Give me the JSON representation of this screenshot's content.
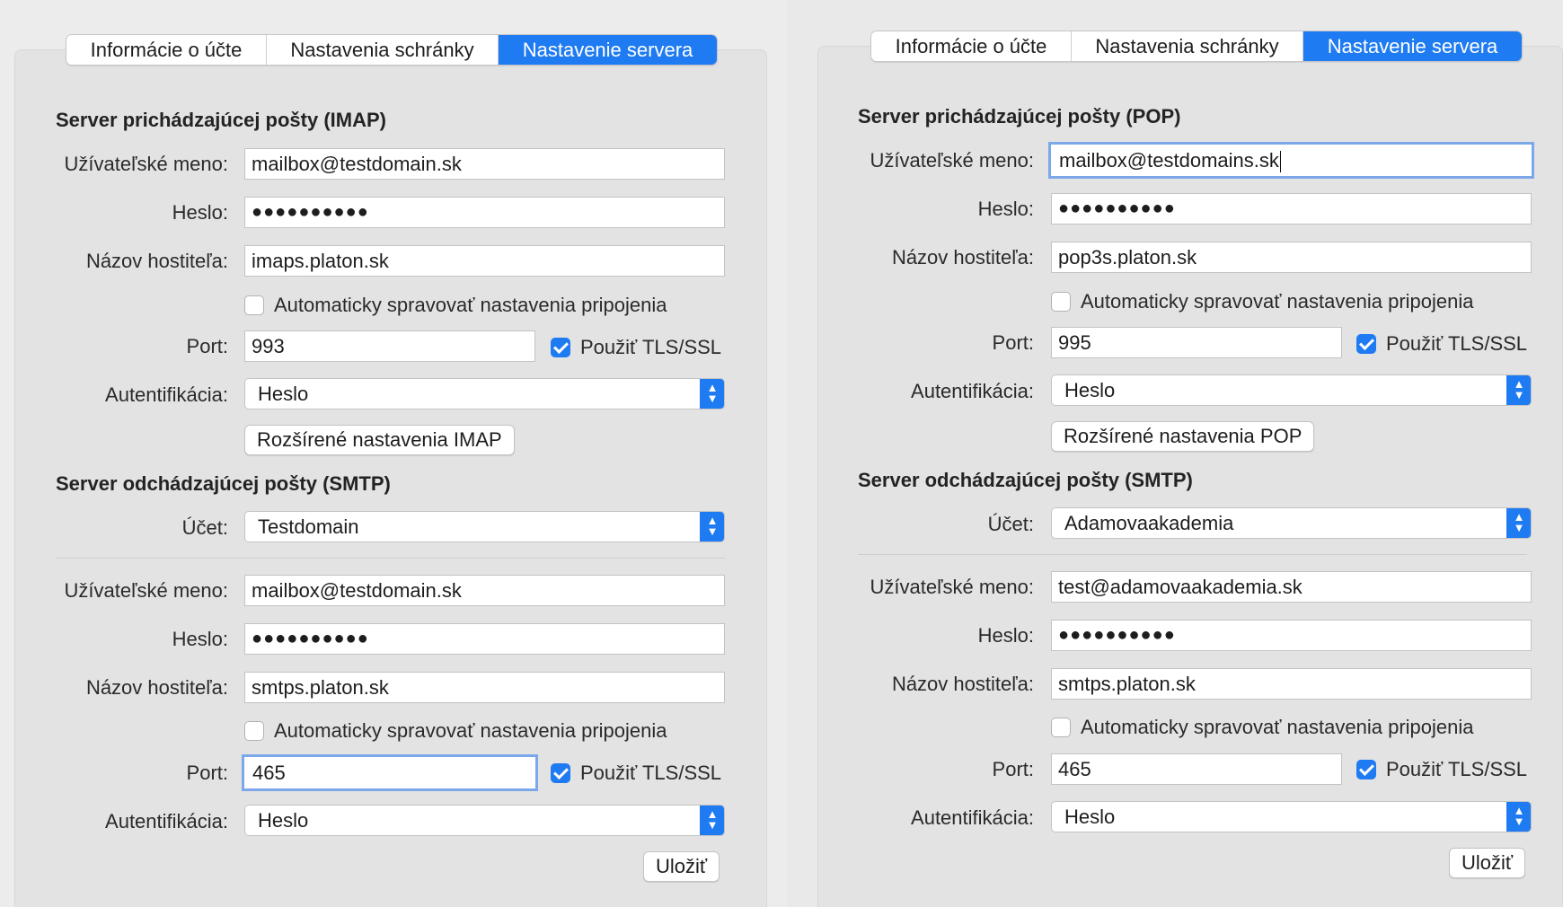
{
  "left": {
    "tabs": [
      "Informácie o účte",
      "Nastavenia schránky",
      "Nastavenie servera"
    ],
    "incoming_title": "Server prichádzajúcej pošty (IMAP)",
    "labels": {
      "username": "Užívateľské meno:",
      "password": "Heslo:",
      "hostname": "Názov hostiteľa:",
      "port": "Port:",
      "auth": "Autentifikácia:",
      "account": "Účet:"
    },
    "incoming": {
      "username": "mailbox@testdomain.sk",
      "password": "●●●●●●●●●●",
      "hostname": "imaps.platon.sk",
      "auto_label": "Automaticky spravovať nastavenia pripojenia",
      "port": "993",
      "tls_label": "Použiť TLS/SSL",
      "auth": "Heslo",
      "advanced_button": "Rozšírené nastavenia IMAP"
    },
    "outgoing_title": "Server odchádzajúcej pošty (SMTP)",
    "outgoing": {
      "account": "Testdomain",
      "username": "mailbox@testdomain.sk",
      "password": "●●●●●●●●●●",
      "hostname": "smtps.platon.sk",
      "auto_label": "Automaticky spravovať nastavenia pripojenia",
      "port": "465",
      "tls_label": "Použiť TLS/SSL",
      "auth": "Heslo"
    },
    "save_button": "Uložiť"
  },
  "right": {
    "tabs": [
      "Informácie o účte",
      "Nastavenia schránky",
      "Nastavenie servera"
    ],
    "incoming_title": "Server prichádzajúcej pošty (POP)",
    "labels": {
      "username": "Užívateľské meno:",
      "password": "Heslo:",
      "hostname": "Názov hostiteľa:",
      "port": "Port:",
      "auth": "Autentifikácia:",
      "account": "Účet:"
    },
    "incoming": {
      "username": "mailbox@testdomains.sk",
      "password": "●●●●●●●●●●",
      "hostname": "pop3s.platon.sk",
      "auto_label": "Automaticky spravovať nastavenia pripojenia",
      "port": "995",
      "tls_label": "Použiť TLS/SSL",
      "auth": "Heslo",
      "advanced_button": "Rozšírené nastavenia POP"
    },
    "outgoing_title": "Server odchádzajúcej pošty (SMTP)",
    "outgoing": {
      "account": "Adamovaakademia",
      "username": "test@adamovaakademia.sk",
      "password": "●●●●●●●●●●",
      "hostname": "smtps.platon.sk",
      "auto_label": "Automaticky spravovať nastavenia pripojenia",
      "port": "465",
      "tls_label": "Použiť TLS/SSL",
      "auth": "Heslo"
    },
    "save_button": "Uložiť"
  }
}
